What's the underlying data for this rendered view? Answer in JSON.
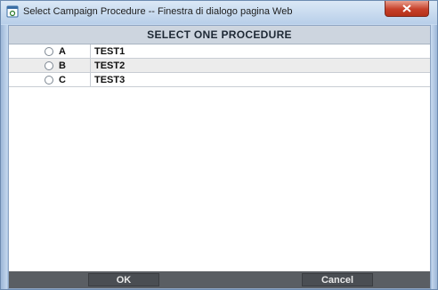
{
  "window": {
    "title": "Select Campaign Procedure -- Finestra di dialogo pagina Web",
    "close_glyph": "x"
  },
  "dialog": {
    "header": "SELECT ONE PROCEDURE",
    "options": [
      {
        "letter": "A",
        "value": "TEST1"
      },
      {
        "letter": "B",
        "value": "TEST2"
      },
      {
        "letter": "C",
        "value": "TEST3"
      }
    ]
  },
  "footer": {
    "ok_label": "OK",
    "cancel_label": "Cancel"
  },
  "colors": {
    "header_bg": "#cdd5df",
    "footer_bg": "#5a5e63",
    "close_red": "#c6402a"
  }
}
